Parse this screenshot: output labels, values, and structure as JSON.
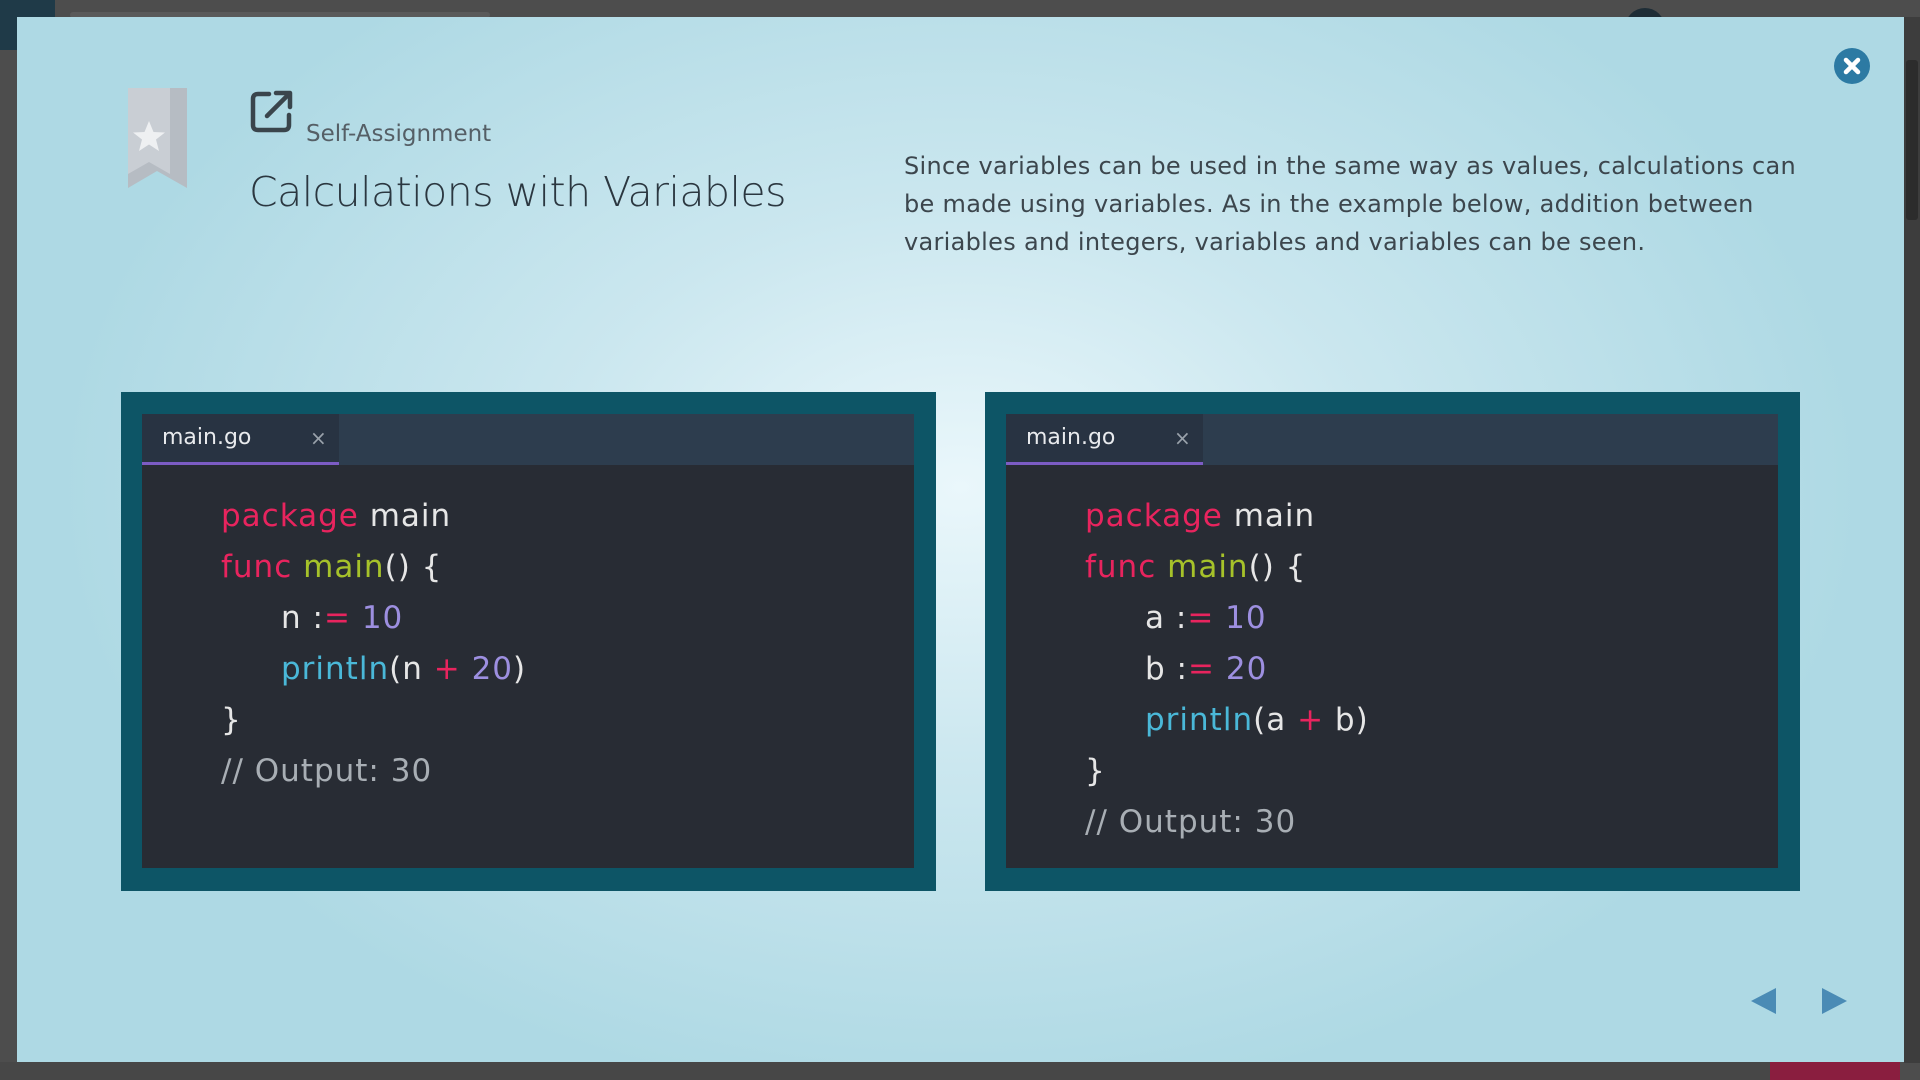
{
  "colors": {
    "modal_background": "#cbe7ef",
    "code_panel": "#0d5566",
    "editor_background": "#282c34",
    "keyword": "#e8245e",
    "function_name": "#a6c22a",
    "number": "#9d8fe0",
    "builtin_call": "#4ab8d8",
    "tab_underline": "#7c5cc4",
    "close_button": "#2c7aa3",
    "nav_arrows": "#4a8bb5"
  },
  "header": {
    "category_icon": "external-link-icon",
    "category": "Self-Assignment",
    "title": "Calculations with Variables"
  },
  "description": "Since variables can be used in the same way as values, calculations can be made using variables. As in the example below, addition between variables and integers, variables and variables can be seen.",
  "examples": [
    {
      "tab_label": "main.go",
      "tab_close": "×",
      "lines": [
        {
          "kw": "package",
          "rest": " main"
        },
        {
          "kw": "func",
          "fn": "main",
          "rest": "() {"
        },
        {
          "var": "n",
          "assign": ":",
          "op": "=",
          "num": "10"
        },
        {
          "call": "println",
          "open": "(n ",
          "op": "+",
          "num": "20",
          "close": ")"
        },
        {
          "rest": "}"
        },
        {
          "comment": "// Output: 30"
        }
      ]
    },
    {
      "tab_label": "main.go",
      "tab_close": "×",
      "lines": [
        {
          "kw": "package",
          "rest": " main"
        },
        {
          "kw": "func",
          "fn": "main",
          "rest": "() {"
        },
        {
          "var": "a",
          "assign": ":",
          "op": "=",
          "num": "10"
        },
        {
          "var": "b",
          "assign": ":",
          "op": "=",
          "num": "20"
        },
        {
          "call": "println",
          "open": "(a ",
          "op": "+",
          "close": " b)"
        },
        {
          "rest": "}"
        },
        {
          "comment": "// Output: 30"
        }
      ]
    }
  ],
  "controls": {
    "close_icon": "close-icon",
    "bookmark_icon": "bookmark-star-icon",
    "prev_icon": "triangle-left-icon",
    "next_icon": "triangle-right-icon"
  }
}
